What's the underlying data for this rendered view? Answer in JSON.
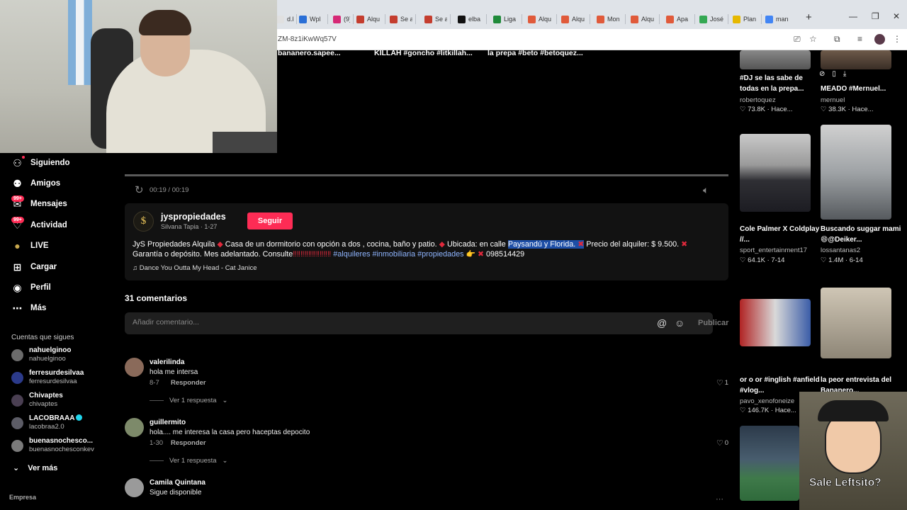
{
  "browser": {
    "tabs": [
      {
        "label": "d.kn",
        "color": "#e0e0e0"
      },
      {
        "label": "Wpl",
        "color": "#2a6fd6"
      },
      {
        "label": "(9) I",
        "color": "#d62976"
      },
      {
        "label": "Alqu",
        "color": "#c43d2e"
      },
      {
        "label": "Se al",
        "color": "#c43d2e"
      },
      {
        "label": "Se al",
        "color": "#c43d2e"
      },
      {
        "label": "elba",
        "color": "#111111"
      },
      {
        "label": "Liga",
        "color": "#1f8a3a"
      },
      {
        "label": "Alqu",
        "color": "#e05a3a"
      },
      {
        "label": "Alqu",
        "color": "#e05a3a"
      },
      {
        "label": "Mon",
        "color": "#e05a3a"
      },
      {
        "label": "Alqu",
        "color": "#e05a3a"
      },
      {
        "label": "Apa",
        "color": "#e05a3a"
      },
      {
        "label": "José",
        "color": "#34a853"
      },
      {
        "label": "Plan",
        "color": "#e6b800"
      },
      {
        "label": "man",
        "color": "#4285f4"
      }
    ],
    "new_tab": "+",
    "url": "ZM-8z1iKwWq57V"
  },
  "webcam": {
    "label": "webcam-overlay"
  },
  "nav": {
    "items": [
      {
        "label": "Siguiendo",
        "icon": "following-icon",
        "badge": ""
      },
      {
        "label": "Amigos",
        "icon": "friends-icon",
        "badge": ""
      },
      {
        "label": "Mensajes",
        "icon": "messages-icon",
        "badge": "99+"
      },
      {
        "label": "Actividad",
        "icon": "activity-icon",
        "badge": "99+"
      },
      {
        "label": "LIVE",
        "icon": "live-icon",
        "badge": ""
      },
      {
        "label": "Cargar",
        "icon": "upload-icon",
        "badge": ""
      },
      {
        "label": "Perfil",
        "icon": "profile-icon",
        "badge": ""
      },
      {
        "label": "Más",
        "icon": "more-icon",
        "badge": ""
      }
    ],
    "following_title": "Cuentas que sigues",
    "following": [
      {
        "name": "nahuelginoo",
        "user": "nahuelginoo",
        "color": "#6b6b6b",
        "verified": false
      },
      {
        "name": "ferresurdesilvaa",
        "user": "ferresurdesilvaa",
        "color": "#2b3a8a",
        "verified": false
      },
      {
        "name": "Chivaptes",
        "user": "chivaptes",
        "color": "#4a3f52",
        "verified": false
      },
      {
        "name": "LACOBRAAA",
        "user": "lacobraa2.0",
        "color": "#5c5c66",
        "verified": true
      },
      {
        "name": "buenasnochesco...",
        "user": "buenasnochesconkev",
        "color": "#7a7a7a",
        "verified": false
      }
    ],
    "see_more": "Ver más",
    "company": "Empresa"
  },
  "strip": {
    "captions": [
      "bananero.sapee...",
      "KILLAH #goncho #litkillah...",
      "la prepa #beto #betoquez..."
    ]
  },
  "video": {
    "progress": 1.0,
    "time": "00:19 / 00:19"
  },
  "post": {
    "author_handle": "jyspropiedades",
    "author_sub": "Silvana Tapia · 1-27",
    "follow_label": "Seguir",
    "desc_part1": "JyS Propiedades Alquila ",
    "desc_part2": " Casa de un dormitorio con opción a dos , cocina, baño y patio. ",
    "desc_part3": " Ubicada: en calle ",
    "desc_highlight": "Paysandú y Florida. ",
    "desc_part4": "Precio del alquiler: $ 9.500. ",
    "desc_part5": "Garantía o depósito. Mes adelantado. Consulte",
    "desc_marks": "‼‼‼‼‼‼‼‼‼‼",
    "desc_tags": " #alquileres #inmobiliaria #propiedades",
    "desc_phone": " 098514429",
    "music": "Dance You Outta My Head - Cat Janice"
  },
  "comments": {
    "count_label": "31 comentarios",
    "placeholder": "Añadir comentario...",
    "publish_label": "Publicar",
    "items": [
      {
        "user": "valerilinda",
        "text": "hola me intersa",
        "date": "8-7",
        "reply": "Responder",
        "likes": "1",
        "more": "Ver 1 respuesta",
        "avatar": "#8a6a5a"
      },
      {
        "user": "guillermito",
        "text": "hola.... me interesa la casa pero haceptas depocito",
        "date": "1-30",
        "reply": "Responder",
        "likes": "0",
        "more": "Ver 1 respuesta",
        "avatar": "#7d8a6a"
      },
      {
        "user": "Camila Quintana",
        "text": "Sigue disponible",
        "date": "",
        "reply": "",
        "likes": "",
        "more": "",
        "avatar": "#9a9a9a"
      }
    ]
  },
  "related": [
    {
      "caption": "#DJ se las sabe de todas en la prepa...",
      "author": "robertoquez",
      "stats": "♡ 73.8K · Hace..."
    },
    {
      "caption": "MEADO #Mernuel...",
      "author": "mernuel",
      "stats": "♡ 38.3K · Hace..."
    },
    {
      "caption": "Cole Palmer X Coldplay //...",
      "author": "sport_entertainment17",
      "stats": "♡ 64.1K · 7-14"
    },
    {
      "caption": "Buscando suggar mami 😄@Deiker...",
      "author": "lossantanas2",
      "stats": "♡ 1.4M · 6-14"
    },
    {
      "caption": "or o or #inglish #anfield #vlog...",
      "author": "pavo_xenofoneize",
      "stats": "♡ 146.7K · Hace..."
    },
    {
      "caption": "la peor entrevista del Bananero...",
      "author": "",
      "stats": ""
    }
  ],
  "meme": {
    "text": "Sale Leftsito?"
  }
}
